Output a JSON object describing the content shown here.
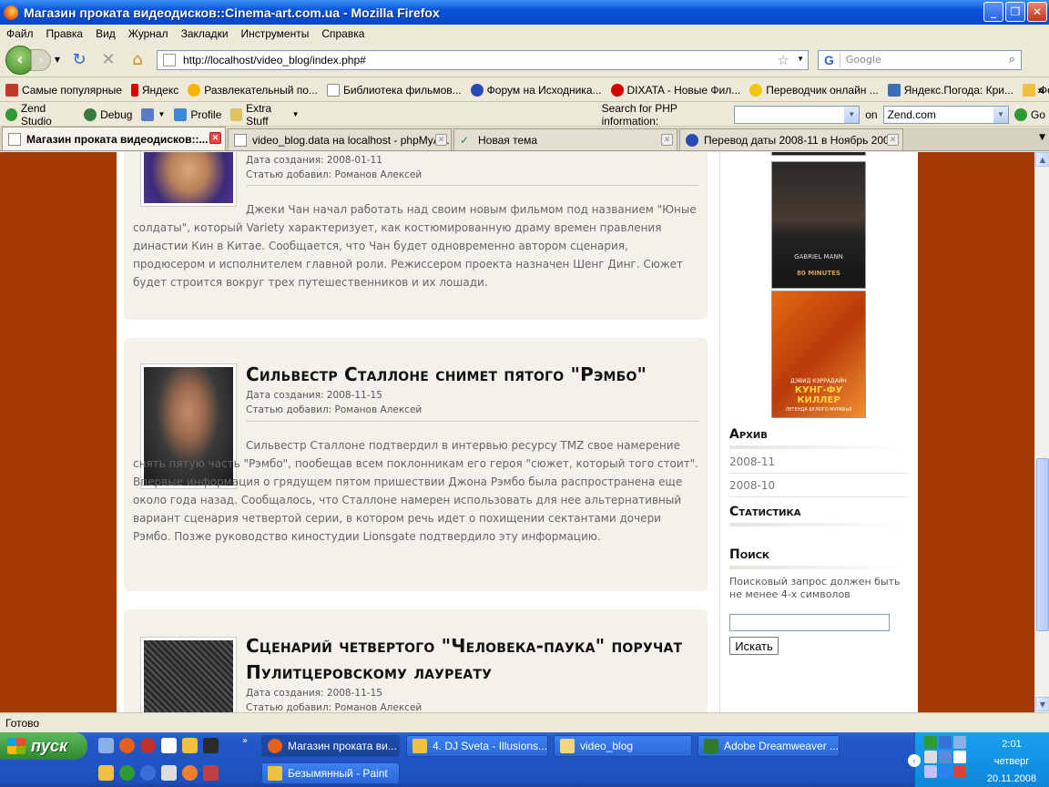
{
  "window": {
    "title": "Магазин проката видеодисков::Cinema-art.com.ua - Mozilla Firefox"
  },
  "menu": [
    "Файл",
    "Правка",
    "Вид",
    "Журнал",
    "Закладки",
    "Инструменты",
    "Справка"
  ],
  "nav": {
    "url": "http://localhost/video_blog/index.php#",
    "search_placeholder": "Google"
  },
  "bookmarks": [
    {
      "label": "Самые популярные",
      "color": "#c0392b"
    },
    {
      "label": "Яндекс",
      "color": "#e00000"
    },
    {
      "label": "Развлекательный по...",
      "color": "#f5b400"
    },
    {
      "label": "Библиотека фильмов...",
      "color": "#ffffff"
    },
    {
      "label": "Форум на Исходника...",
      "color": "#2a4ab5"
    },
    {
      "label": "DIXATA - Новые Фил...",
      "color": "#d10000"
    },
    {
      "label": "Переводчик онлайн ...",
      "color": "#f1c40f"
    },
    {
      "label": "Яндекс.Погода: Кри...",
      "color": "#3a6fb6"
    },
    {
      "label": "Фотошоп",
      "color": "#f0c040"
    }
  ],
  "zend": {
    "items": [
      "Zend Studio",
      "Debug",
      "Profile",
      "Extra Stuff"
    ],
    "search_label": "Search for PHP information:",
    "on_label": "on",
    "site": "Zend.com",
    "go": "Go"
  },
  "tabs": [
    {
      "label": "Магазин проката видеодисков::..."
    },
    {
      "label": "video_blog.data на localhost - phpMyA..."
    },
    {
      "label": "Новая тема"
    },
    {
      "label": "Перевод даты 2008-11 в Ноябрь 200..."
    }
  ],
  "posts": [
    {
      "title": "",
      "date": "Дата создания: 2008-01-11",
      "author": "Статью добавил: Романов Алексей",
      "body": "Джеки Чан начал работать над своим новым фильмом под названием \"Юные солдаты\", который Variety характеризует, как костюмированную драму времен правления династии Кин в Китае. Сообщается, что Чан будет одновременно автором сценария, продюсером и исполнителем главной роли. Режиссером проекта назначен Шенг Динг. Сюжет будет строится вокруг трех путешественников и их лошади."
    },
    {
      "title": "Сильвестр Сталлоне снимет пятого \"Рэмбо\"",
      "date": "Дата создания: 2008-11-15",
      "author": "Статью добавил: Романов Алексей",
      "body": "Сильвестр Сталлоне подтвердил в интервью ресурсу TMZ свое намерение снять пятую часть \"Рэмбо\", пообещав всем поклонникам его героя \"сюжет, который того стоит\". Впервые информация о грядущем пятом пришествии Джона Рэмбо была распространена еще около года назад. Сообщалось, что Сталлоне намерен использовать для нее альтернативный вариант сценария четвертой серии, в котором речь идет о похищении сектантами дочери Рэмбо. Позже руководство киностудии Lionsgate подтвердило эту информацию."
    },
    {
      "title": "Сценарий четвертого \"Человека-паука\" поручат Пулитцеровскому лауреату",
      "date": "Дата создания: 2008-11-15",
      "author": "Статью добавил: Романов Алексей"
    }
  ],
  "posters": [
    {
      "lines": [
        "GABRIEL MANN",
        "80 MINUTES"
      ]
    },
    {
      "lines": [
        "ДЭВИД КЭРРАДАЙН",
        "КУНГ-ФУ",
        "КИЛЛЕР",
        "ЛЕГЕНДА БЕЛОГО МУРАВЬЯ"
      ]
    }
  ],
  "sidebar": {
    "archive_title": "Архив",
    "archive": [
      "2008-11",
      "2008-10"
    ],
    "stats_title": "Статистика",
    "search_title": "Поиск",
    "search_hint": "Поисковый запрос должен быть не менее 4-х символов",
    "search_button": "Искать"
  },
  "status": "Готово",
  "taskbar": {
    "start": "пуск",
    "windows": [
      {
        "label": "Магазин проката ви...",
        "color": "#e8611a"
      },
      {
        "label": "4. DJ Sveta - Illusions...",
        "color": "#f0c040"
      },
      {
        "label": "video_blog",
        "color": "#f5d67a"
      },
      {
        "label": "Adobe Dreamweaver ...",
        "color": "#2f7a30"
      },
      {
        "label": "Безымянный - Paint",
        "color": "#f0c040"
      }
    ],
    "time": "2:01",
    "day": "четверг",
    "date": "20.11.2008"
  }
}
